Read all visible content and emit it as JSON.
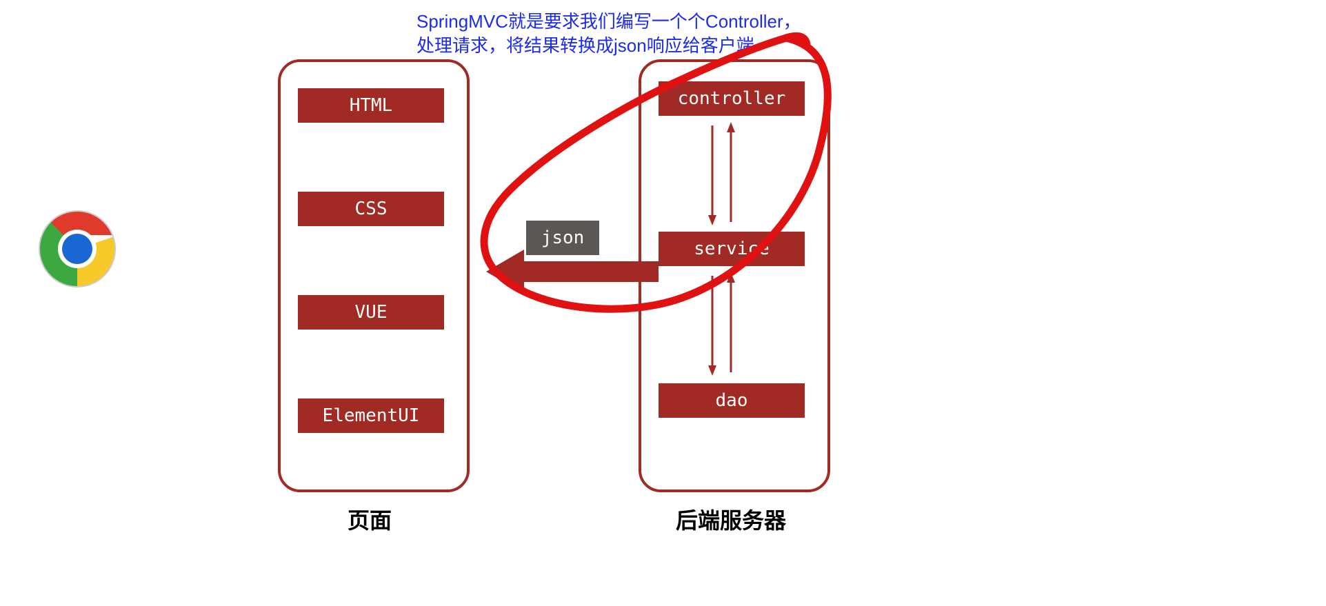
{
  "annotation": {
    "line1": "SpringMVC就是要求我们编写一个个Controller，",
    "line2": "处理请求，将结果转换成json响应给客户端"
  },
  "frontend": {
    "title": "页面",
    "items": [
      "HTML",
      "CSS",
      "VUE",
      "ElementUI"
    ]
  },
  "backend": {
    "title": "后端服务器",
    "items": [
      "controller",
      "service",
      "dao"
    ]
  },
  "transport": {
    "label": "json"
  },
  "colors": {
    "box": "#a12b24",
    "annotation": "#1b2bf0",
    "jsonBox": "#5c5753",
    "scribble": "#e01111"
  },
  "icon": {
    "name": "chrome"
  }
}
